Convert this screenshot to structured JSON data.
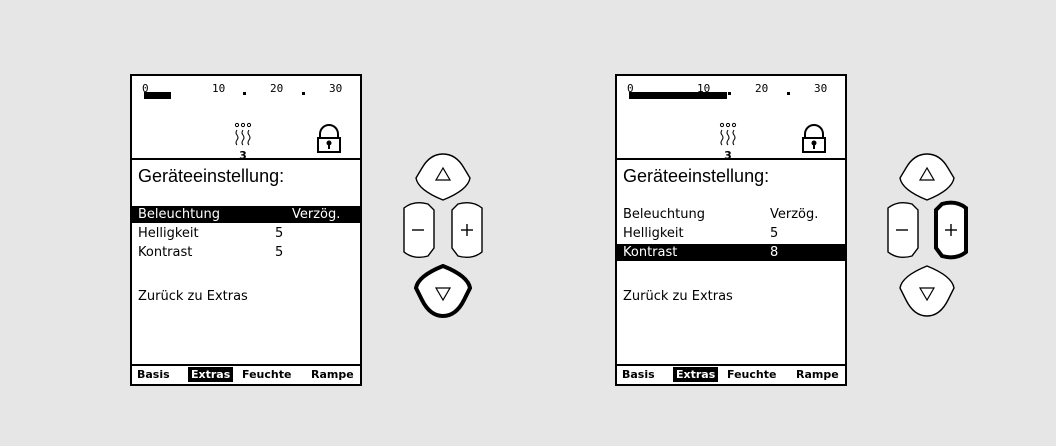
{
  "scale": {
    "labels": [
      "0",
      "10",
      "20",
      "30"
    ]
  },
  "steam": {
    "level": "3"
  },
  "panels": [
    {
      "title": "Geräteeinstellung:",
      "rows": [
        {
          "key": "Beleuchtung",
          "value": "Verzög."
        },
        {
          "key": "Helligkeit",
          "value": "5"
        },
        {
          "key": "Kontrast",
          "value": "5"
        }
      ],
      "selected_row": "Beleuchtung",
      "back": "Zurück zu Extras",
      "tabs": [
        "Basis",
        "Extras",
        "Feuchte",
        "Rampe"
      ],
      "selected_tab": "Extras",
      "bar_fraction": 0.13,
      "active_key": "down"
    },
    {
      "title": "Geräteeinstellung:",
      "rows": [
        {
          "key": "Beleuchtung",
          "value": "Verzög."
        },
        {
          "key": "Helligkeit",
          "value": "5"
        },
        {
          "key": "Kontrast",
          "value": "8"
        }
      ],
      "selected_row": "Kontrast",
      "back": "Zurück zu Extras",
      "tabs": [
        "Basis",
        "Extras",
        "Feuchte",
        "Rampe"
      ],
      "selected_tab": "Extras",
      "bar_fraction": 0.47,
      "active_key": "plus"
    }
  ]
}
